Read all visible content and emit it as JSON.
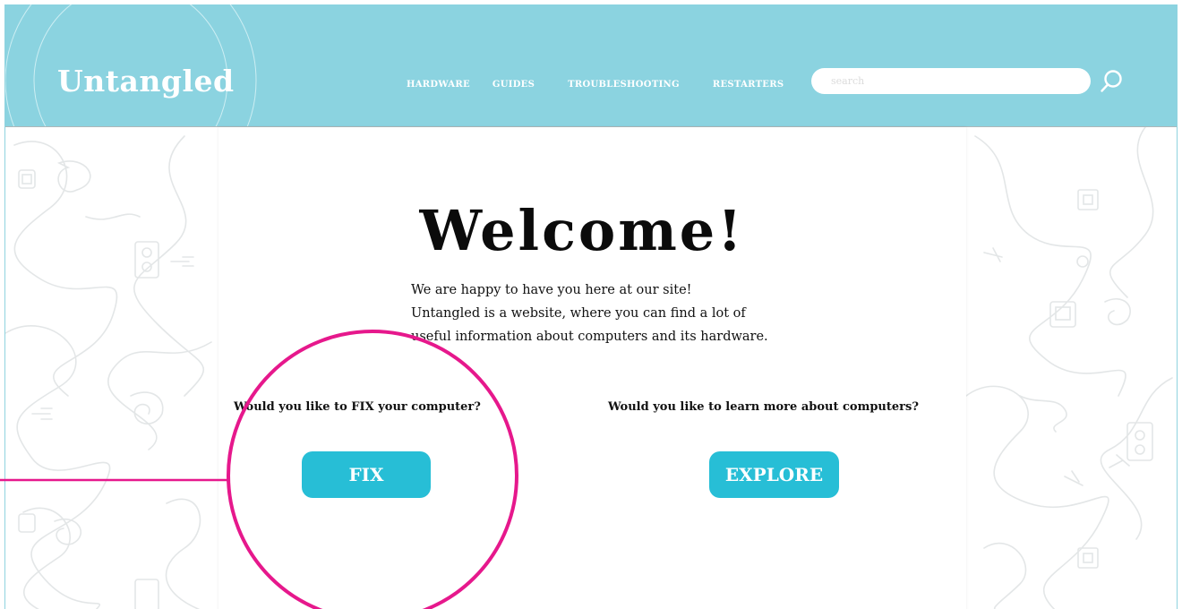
{
  "header": {
    "logo": "Untangled",
    "nav": [
      {
        "label": "HARDWARE"
      },
      {
        "label": "GUIDES"
      },
      {
        "label": "TROUBLESHOOTING"
      },
      {
        "label": "RESTARTERS"
      }
    ],
    "search_placeholder": "search",
    "search_value": ""
  },
  "main": {
    "title": "Welcome!",
    "intro_lines": [
      "We are happy to have you here at our site!",
      "Untangled is a website, where you can find a lot of",
      "useful information about computers and its hardware."
    ],
    "fix_question": "Would you like to FIX your computer?",
    "fix_button": "FIX",
    "explore_question": "Would you like to learn more about computers?",
    "explore_button": "EXPLORE"
  },
  "colors": {
    "header_bg": "#8bd3e0",
    "button_bg": "#27bed6",
    "highlight": "#e6188c",
    "doodle": "#e3e6e7"
  },
  "icons": {
    "search": "search-icon",
    "highlight": "highlight-circle-annotation"
  }
}
